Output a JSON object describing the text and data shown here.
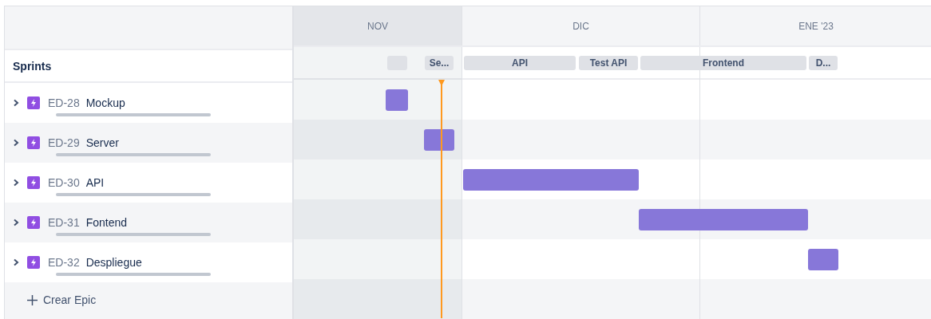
{
  "months": [
    {
      "label": "NOV",
      "past": true
    },
    {
      "label": "DIC",
      "past": false
    },
    {
      "label": "ENE '23",
      "past": false
    }
  ],
  "sprints_label": "Sprints",
  "sprints": [
    {
      "kind": "empty"
    },
    {
      "kind": "named",
      "label": "Se..."
    },
    {
      "kind": "named",
      "label": "API"
    },
    {
      "kind": "named",
      "label": "Test API"
    },
    {
      "kind": "named",
      "label": "Frontend"
    },
    {
      "kind": "named",
      "label": "D..."
    }
  ],
  "epics": [
    {
      "key": "ED-28",
      "name": "Mockup",
      "expanded": false,
      "level": 0
    },
    {
      "key": "ED-29",
      "name": "Server",
      "expanded": false,
      "level": 0
    },
    {
      "key": "ED-30",
      "name": "API",
      "expanded": false,
      "level": 0
    },
    {
      "key": "ED-31",
      "name": "Fontend",
      "expanded": false,
      "level": 0
    },
    {
      "key": "ED-32",
      "name": "Despliegue",
      "expanded": false,
      "level": 0
    }
  ],
  "create_button": "Crear Epic"
}
